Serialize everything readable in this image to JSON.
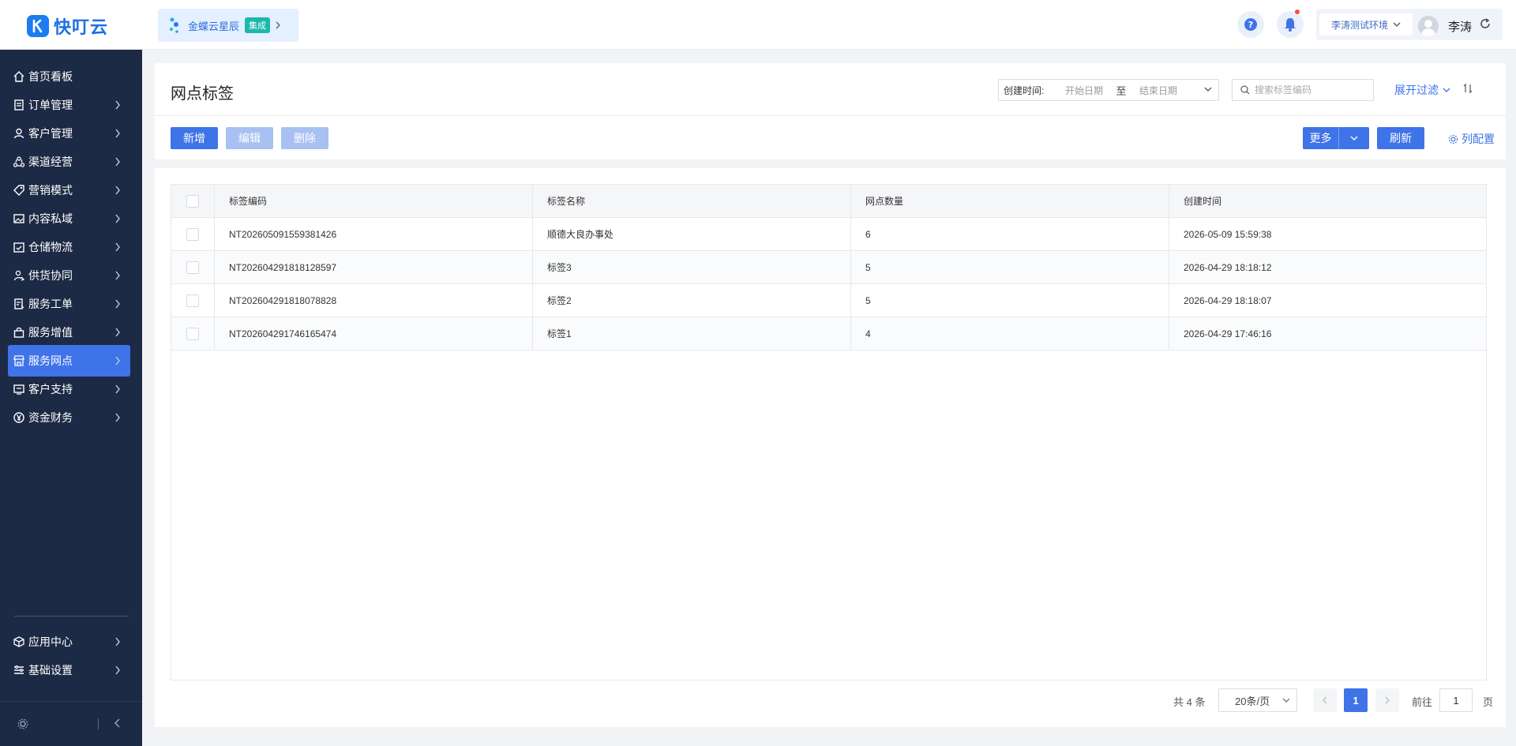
{
  "app": {
    "logo_text": "快叮云"
  },
  "partner": {
    "name": "金蝶云星辰",
    "badge": "集成"
  },
  "header": {
    "env": "李涛测试环境",
    "user_name": "李涛"
  },
  "sidebar": {
    "items": [
      {
        "label": "首页看板",
        "icon": "home-icon",
        "has_arrow": false
      },
      {
        "label": "订单管理",
        "icon": "order-icon",
        "has_arrow": true
      },
      {
        "label": "客户管理",
        "icon": "customer-icon",
        "has_arrow": true
      },
      {
        "label": "渠道经营",
        "icon": "channel-icon",
        "has_arrow": true
      },
      {
        "label": "营销模式",
        "icon": "tag-icon",
        "has_arrow": true
      },
      {
        "label": "内容私域",
        "icon": "image-icon",
        "has_arrow": true
      },
      {
        "label": "仓储物流",
        "icon": "warehouse-icon",
        "has_arrow": true
      },
      {
        "label": "供货协同",
        "icon": "supply-icon",
        "has_arrow": true
      },
      {
        "label": "服务工单",
        "icon": "workorder-icon",
        "has_arrow": true
      },
      {
        "label": "服务增值",
        "icon": "bag-icon",
        "has_arrow": true
      },
      {
        "label": "服务网点",
        "icon": "store-icon",
        "has_arrow": true,
        "active": true
      },
      {
        "label": "客户支持",
        "icon": "support-icon",
        "has_arrow": true
      },
      {
        "label": "资金财务",
        "icon": "yen-icon",
        "has_arrow": true
      }
    ],
    "bottom_items": [
      {
        "label": "应用中心",
        "icon": "cube-icon"
      },
      {
        "label": "基础设置",
        "icon": "settings-list-icon"
      }
    ]
  },
  "page": {
    "title": "网点标签",
    "filters": {
      "date_label": "创建时间:",
      "start_placeholder": "开始日期",
      "range_sep": "至",
      "end_placeholder": "结束日期",
      "search_placeholder": "搜索标签编码",
      "expand_label": "展开过滤"
    },
    "toolbar": {
      "add": "新增",
      "edit": "编辑",
      "delete": "删除",
      "more": "更多",
      "refresh": "刷新",
      "column_config": "列配置"
    }
  },
  "table": {
    "columns": [
      "标签编码",
      "标签名称",
      "网点数量",
      "创建时间"
    ],
    "rows": [
      [
        "NT202605091559381426",
        "顺德大良办事处",
        "6",
        "2026-05-09 15:59:38"
      ],
      [
        "NT202604291818128597",
        "标签3",
        "5",
        "2026-04-29 18:18:12"
      ],
      [
        "NT202604291818078828",
        "标签2",
        "5",
        "2026-04-29 18:18:07"
      ],
      [
        "NT202604291746165474",
        "标签1",
        "4",
        "2026-04-29 17:46:16"
      ]
    ]
  },
  "pagination": {
    "total_text": "共 4 条",
    "page_size": "20条/页",
    "current_page": "1",
    "goto_label": "前往",
    "goto_value": "1",
    "page_unit": "页"
  },
  "colors": {
    "primary": "#3f73e8",
    "sidebar_bg": "#1d2a45",
    "disabled": "#a8c0f2"
  }
}
